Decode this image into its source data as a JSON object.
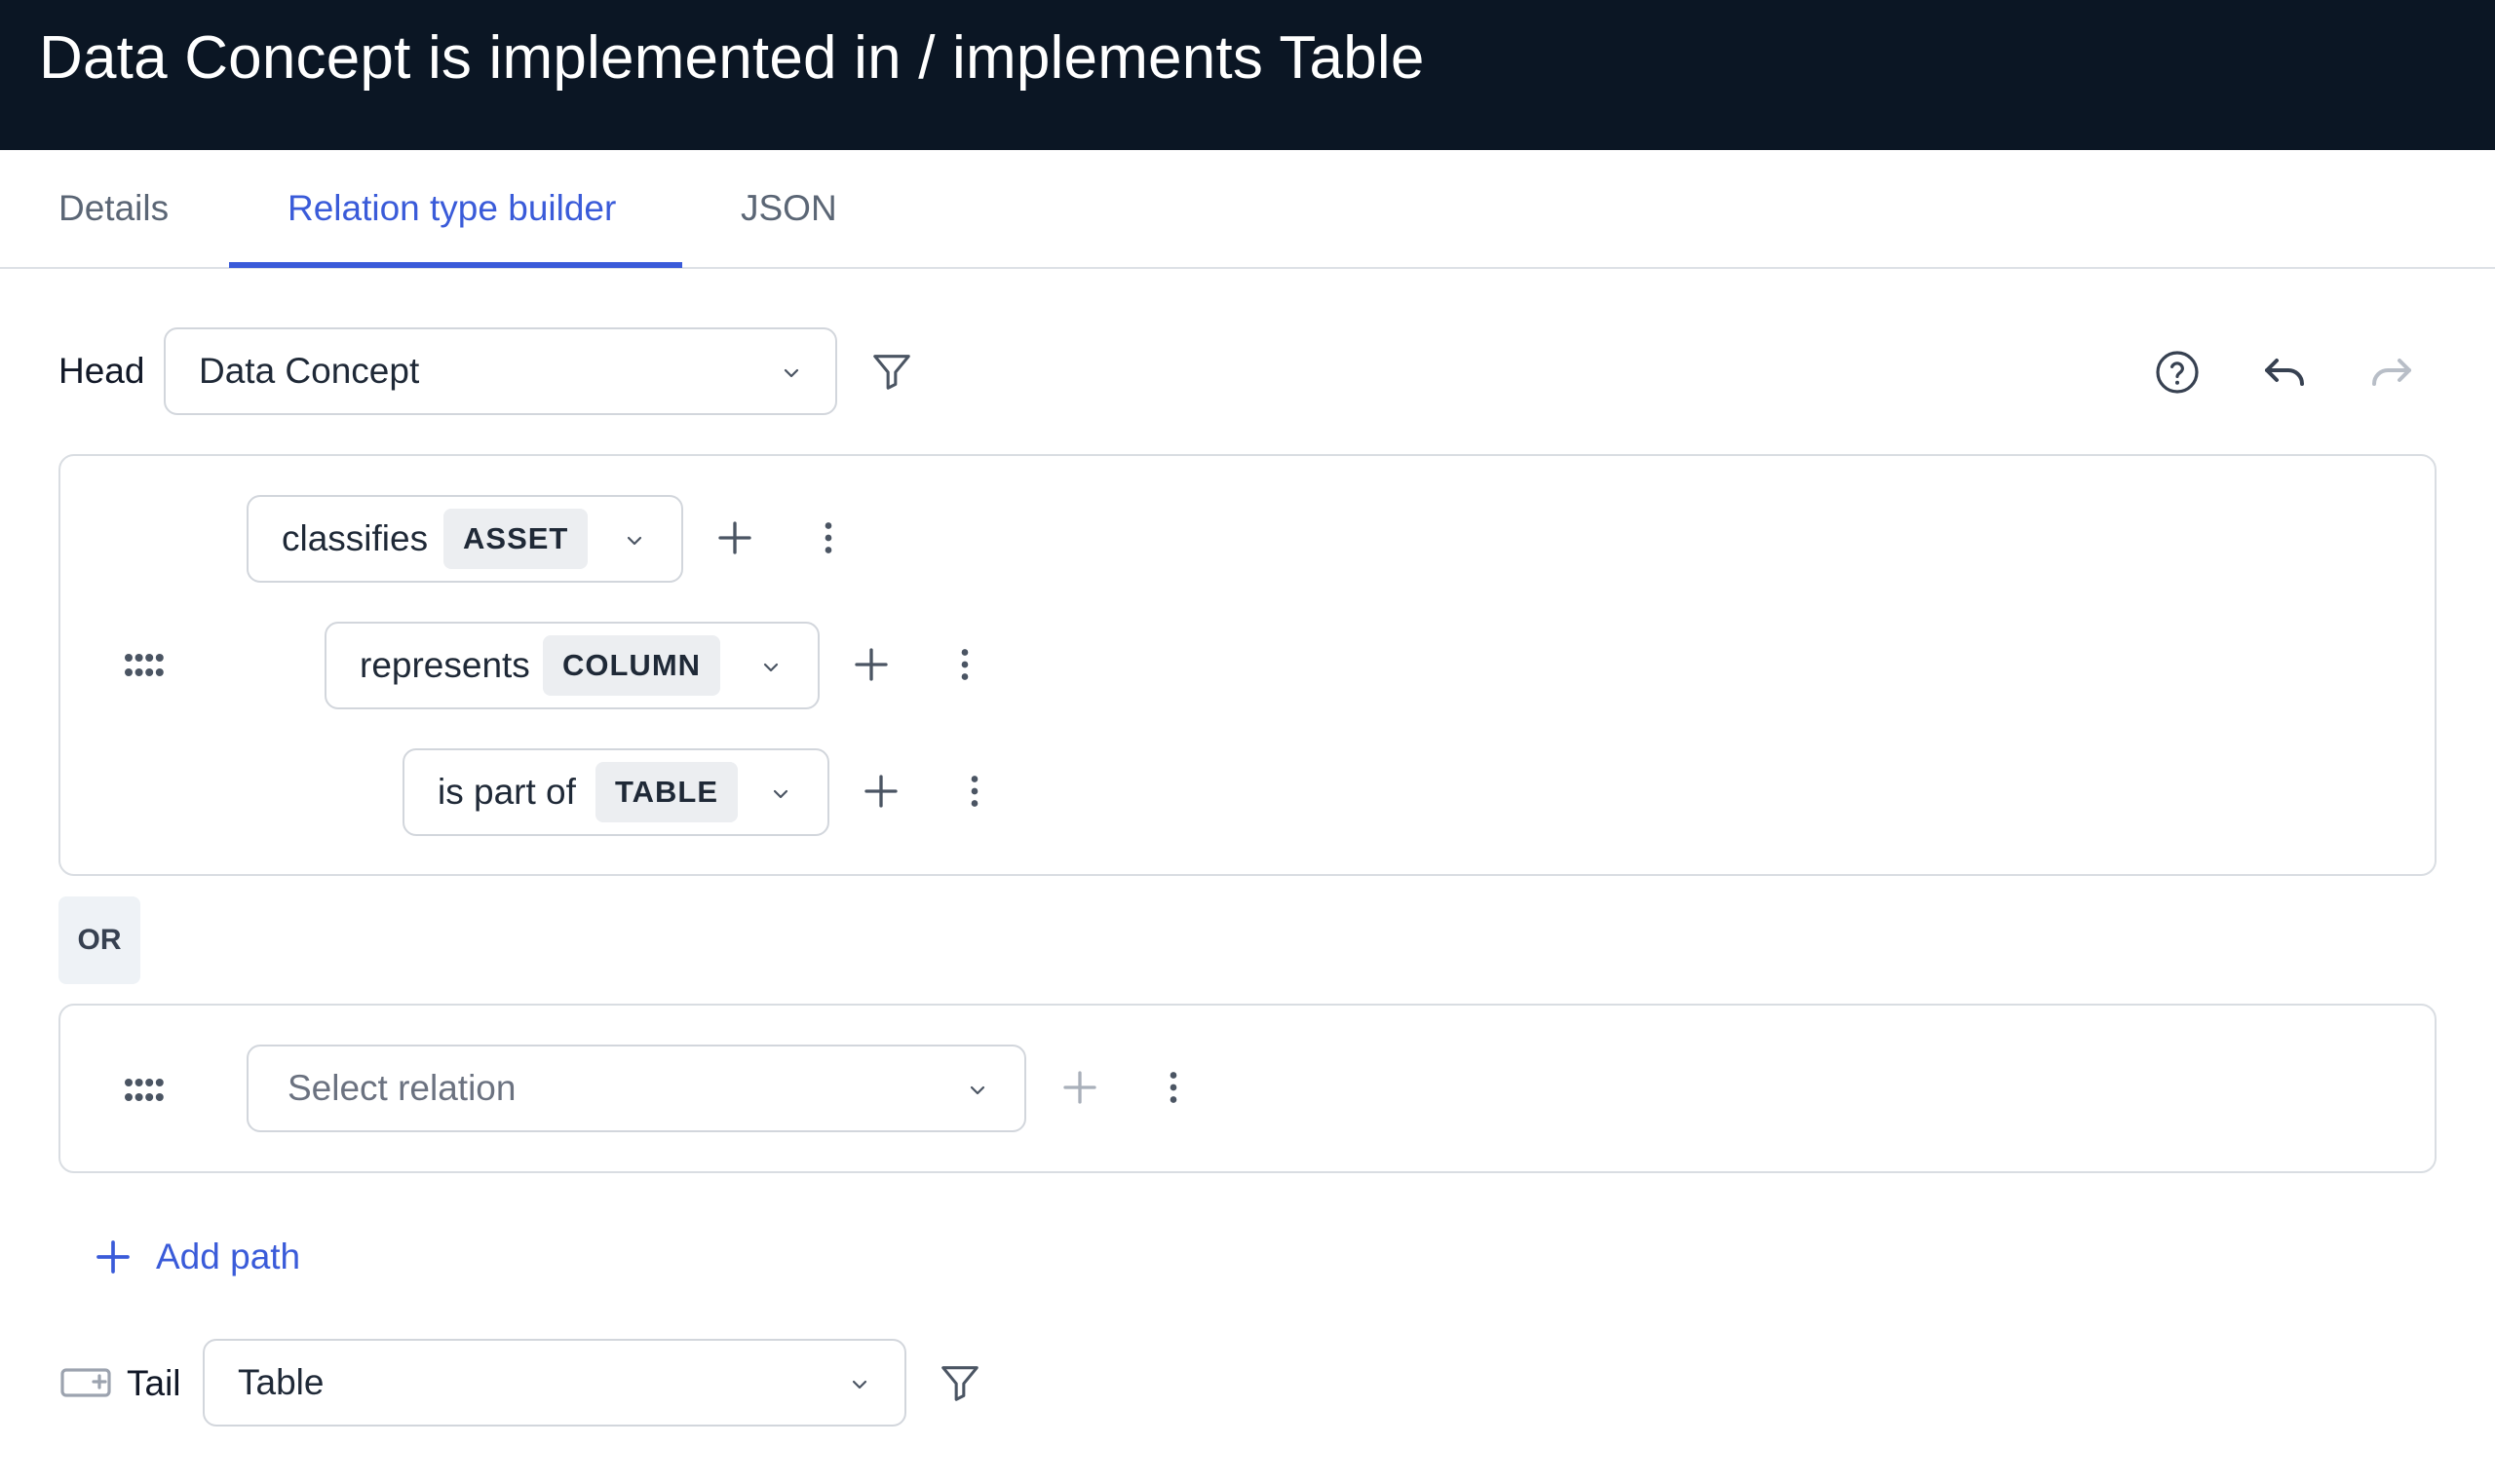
{
  "header": {
    "title": "Data Concept is implemented in / implements Table"
  },
  "tabs": [
    {
      "label": "Details"
    },
    {
      "label": "Relation type builder",
      "active": true
    },
    {
      "label": "JSON"
    }
  ],
  "head": {
    "label": "Head",
    "value": "Data Concept"
  },
  "toolbar": {
    "help_icon": "help-circle-icon",
    "undo_icon": "undo-icon",
    "redo_icon": "redo-icon"
  },
  "path1": {
    "steps": [
      {
        "relation": "classifies",
        "type": "ASSET"
      },
      {
        "relation": "represents",
        "type": "COLUMN"
      },
      {
        "relation": "is part of",
        "type": "TABLE"
      }
    ]
  },
  "or_label": "OR",
  "path2": {
    "placeholder": "Select relation"
  },
  "add_path_label": "Add path",
  "tail": {
    "label": "Tail",
    "value": "Table"
  },
  "colors": {
    "header_bg": "#0b1624",
    "accent": "#3a5bd9"
  }
}
